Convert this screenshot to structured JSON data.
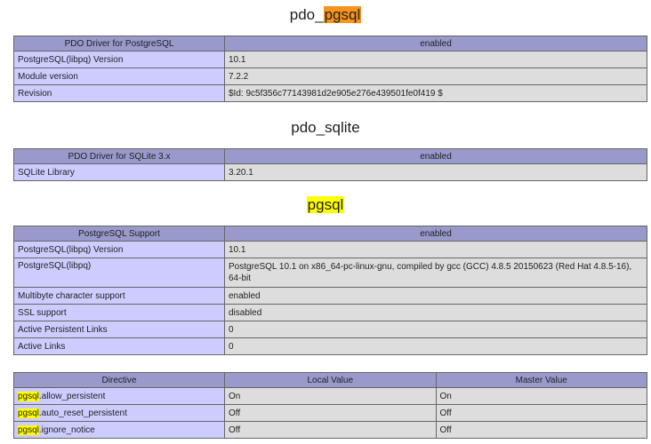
{
  "sections": {
    "pdo_pgsql": {
      "title_prefix": "pdo_",
      "title_highlight": "pgsql",
      "header": [
        "PDO Driver for PostgreSQL",
        "enabled"
      ],
      "rows": [
        [
          "PostgreSQL(libpq) Version",
          "10.1"
        ],
        [
          "Module version",
          "7.2.2"
        ],
        [
          "Revision",
          "$Id: 9c5f356c77143981d2e905e276e439501fe0f419 $"
        ]
      ]
    },
    "pdo_sqlite": {
      "title": "pdo_sqlite",
      "header": [
        "PDO Driver for SQLite 3.x",
        "enabled"
      ],
      "rows": [
        [
          "SQLite Library",
          "3.20.1"
        ]
      ]
    },
    "pgsql": {
      "title_highlight": "pgsql",
      "header": [
        "PostgreSQL Support",
        "enabled"
      ],
      "rows": [
        [
          "PostgreSQL(libpq) Version",
          "10.1"
        ],
        [
          "PostgreSQL(libpq)",
          "PostgreSQL 10.1 on x86_64-pc-linux-gnu, compiled by gcc (GCC) 4.8.5 20150623 (Red Hat 4.8.5-16), 64-bit"
        ],
        [
          "Multibyte character support",
          "enabled"
        ],
        [
          "SSL support",
          "disabled"
        ],
        [
          "Active Persistent Links",
          "0"
        ],
        [
          "Active Links",
          "0"
        ]
      ]
    },
    "directives": {
      "header": [
        "Directive",
        "Local Value",
        "Master Value"
      ],
      "rows": [
        {
          "prefix": "pgsql",
          "name": ".allow_persistent",
          "local": "On",
          "master": "On"
        },
        {
          "prefix": "pgsql",
          "name": ".auto_reset_persistent",
          "local": "Off",
          "master": "Off"
        },
        {
          "prefix": "pgsql",
          "name": ".ignore_notice",
          "local": "Off",
          "master": "Off"
        }
      ]
    }
  }
}
